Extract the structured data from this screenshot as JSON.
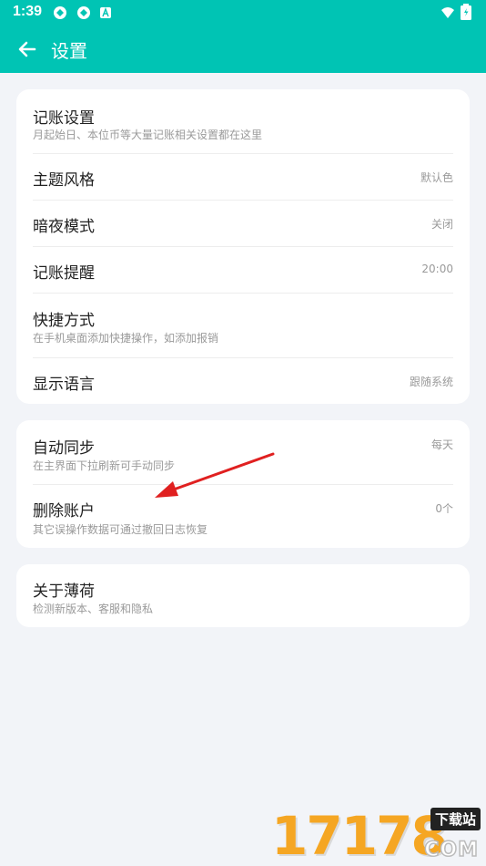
{
  "status_bar": {
    "time": "1:39",
    "icons": [
      "vpn-icon",
      "vpn-icon",
      "notification-a-icon"
    ],
    "right_icons": [
      "wifi-icon",
      "battery-icon"
    ]
  },
  "app_bar": {
    "title": "设置",
    "back_icon": "arrow-left-icon",
    "color": "#00c4b4"
  },
  "section1": [
    {
      "title": "记账设置",
      "subtitle": "月起始日、本位币等大量记账相关设置都在这里",
      "value": ""
    },
    {
      "title": "主题风格",
      "subtitle": "",
      "value": "默认色"
    },
    {
      "title": "暗夜模式",
      "subtitle": "",
      "value": "关闭"
    },
    {
      "title": "记账提醒",
      "subtitle": "",
      "value": "20:00"
    },
    {
      "title": "快捷方式",
      "subtitle": "在手机桌面添加快捷操作，如添加报销",
      "value": ""
    },
    {
      "title": "显示语言",
      "subtitle": "",
      "value": "跟随系统"
    }
  ],
  "section2": [
    {
      "title": "自动同步",
      "subtitle": "在主界面下拉刷新可手动同步",
      "value": "每天"
    },
    {
      "title": "删除账户",
      "subtitle": "其它误操作数据可通过撤回日志恢复",
      "value": "0个"
    }
  ],
  "section3": [
    {
      "title": "关于薄荷",
      "subtitle": "检测新版本、客服和隐私",
      "value": ""
    }
  ],
  "watermark": {
    "number": "17178",
    "tag": "下载站",
    "domain": "COM"
  }
}
